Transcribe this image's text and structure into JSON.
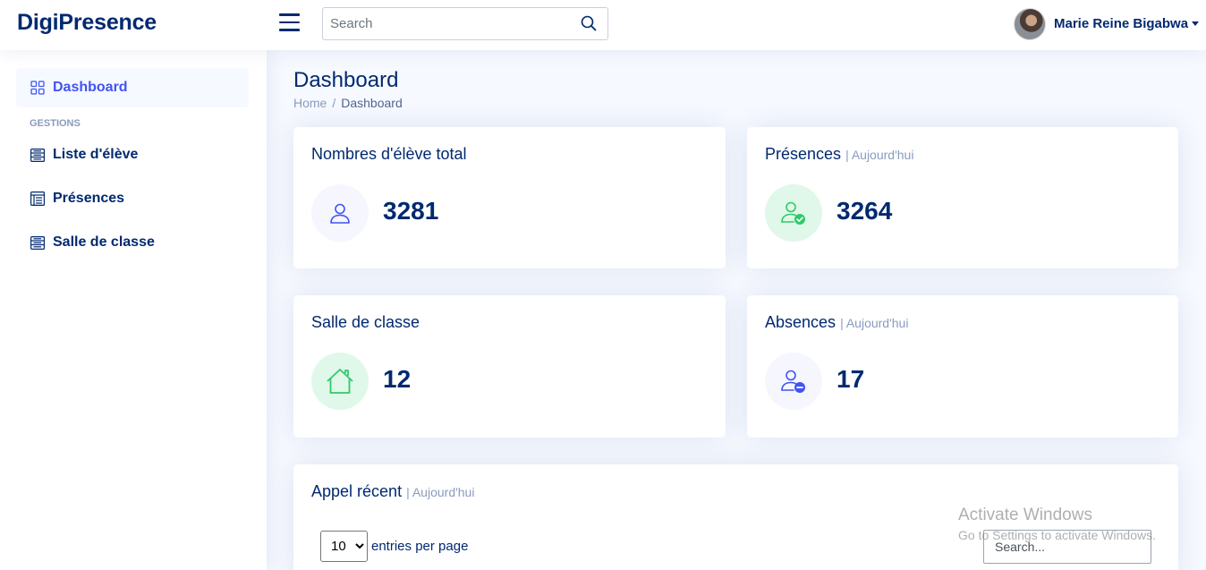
{
  "header": {
    "logo": "DigiPresence",
    "search_placeholder": "Search",
    "user_name": "Marie Reine Bigabwa"
  },
  "sidebar": {
    "dashboard_label": "Dashboard",
    "section_heading": "GESTIONS",
    "items": [
      {
        "label": "Liste d'élève",
        "icon": "list-icon"
      },
      {
        "label": "Présences",
        "icon": "clipboard-icon"
      },
      {
        "label": "Salle de classe",
        "icon": "list-icon"
      }
    ]
  },
  "main": {
    "page_title": "Dashboard",
    "breadcrumb": {
      "home": "Home",
      "separator": "/",
      "current": "Dashboard"
    },
    "cards": {
      "students": {
        "title": "Nombres d'élève total",
        "subtitle": "",
        "value": "3281",
        "icon": "user-icon",
        "icon_bg": "#f6f6fe",
        "icon_color": "#4154f1"
      },
      "presences": {
        "title": "Présences",
        "subtitle": "| Aujourd'hui",
        "value": "3264",
        "icon": "user-check-icon",
        "icon_bg": "#e0f8e9",
        "icon_color": "#2eca6a"
      },
      "classrooms": {
        "title": "Salle de classe",
        "subtitle": "",
        "value": "12",
        "icon": "house-icon",
        "icon_bg": "#e0f8e9",
        "icon_color": "#2eca6a"
      },
      "absences": {
        "title": "Absences",
        "subtitle": "| Aujourd'hui",
        "value": "17",
        "icon": "user-minus-icon",
        "icon_bg": "#f6f6fe",
        "icon_color": "#4154f1"
      }
    },
    "recent": {
      "title": "Appel récent",
      "subtitle": "| Aujourd'hui",
      "per_page_value": "10",
      "per_page_label": "entries per page",
      "search_placeholder": "Search..."
    }
  },
  "watermark": {
    "line1": "Activate Windows",
    "line2": "Go to Settings to activate Windows."
  }
}
